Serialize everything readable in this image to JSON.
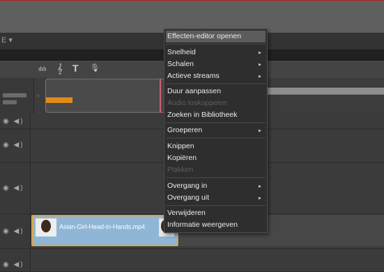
{
  "toolbar": {
    "menu_hint": "E ▾"
  },
  "timeline_tools": [
    {
      "name": "audio-mixer-icon",
      "glyph": "ılılı"
    },
    {
      "name": "music-note-icon",
      "glyph": "𝄞"
    },
    {
      "name": "title-icon",
      "glyph": "T"
    },
    {
      "name": "microphone-icon",
      "glyph": "🎙"
    }
  ],
  "tracks": [
    {
      "eye": "◉",
      "speaker": "◀)"
    },
    {
      "eye": "◉",
      "speaker": "◀)"
    },
    {
      "eye": "◉",
      "speaker": "◀)"
    },
    {
      "eye": "◉",
      "speaker": "◀)"
    },
    {
      "eye": "◉",
      "speaker": "◀)"
    }
  ],
  "clip": {
    "label": "Asian-Girl-Head-in-Hands.mp4"
  },
  "context_menu": {
    "items": [
      {
        "label": "Effecten-editor openen",
        "enabled": true,
        "highlighted": true
      },
      {
        "label": "Snelheid",
        "enabled": true,
        "submenu": true
      },
      {
        "label": "Schalen",
        "enabled": true,
        "submenu": true
      },
      {
        "label": "Actieve streams",
        "enabled": true,
        "submenu": true
      },
      {
        "label": "Duur aanpassen",
        "enabled": true
      },
      {
        "label": "Audio loskoppelen",
        "enabled": false
      },
      {
        "label": "Zoeken in Bibliotheek",
        "enabled": true
      },
      {
        "label": "Groeperen",
        "enabled": true,
        "submenu": true
      },
      {
        "label": "Knippen",
        "enabled": true
      },
      {
        "label": "Kopiëren",
        "enabled": true
      },
      {
        "label": "Plakken",
        "enabled": false
      },
      {
        "label": "Overgang in",
        "enabled": true,
        "submenu": true
      },
      {
        "label": "Overgang uit",
        "enabled": true,
        "submenu": true
      },
      {
        "label": "Verwijderen",
        "enabled": true
      },
      {
        "label": "Informatie weergeven",
        "enabled": true
      }
    ],
    "submenu_arrow": "▸"
  },
  "colors": {
    "clip_fill": "#8fb6d6",
    "clip_border": "#f0a020",
    "menu_bg": "#2e2e2e",
    "playhead": "#d06070"
  }
}
